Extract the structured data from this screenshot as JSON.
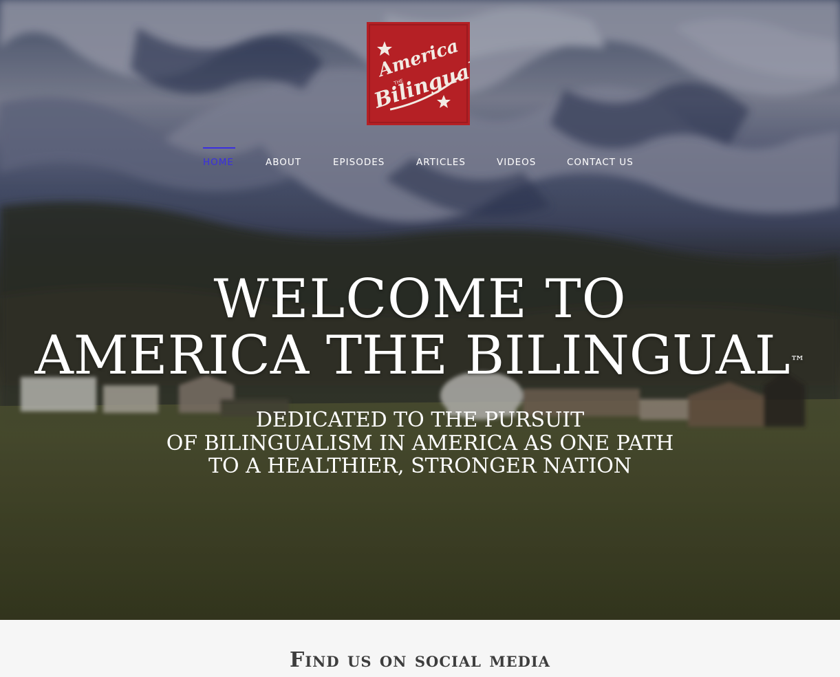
{
  "logo": {
    "line1": "America",
    "line_small": "THE",
    "line2": "Bilingual",
    "background": "#b52025"
  },
  "nav": {
    "items": [
      {
        "label": "HOME",
        "active": true
      },
      {
        "label": "ABOUT"
      },
      {
        "label": "EPISODES"
      },
      {
        "label": "ARTICLES"
      },
      {
        "label": "VIDEOS"
      },
      {
        "label": "CONTACT US"
      }
    ],
    "active_color": "#3a2fe0"
  },
  "hero": {
    "title_line1": "WELCOME TO",
    "title_line2": "AMERICA THE BILINGUAL",
    "trademark": "™",
    "subtitle_line1": "DEDICATED TO THE PURSUIT",
    "subtitle_line2": "OF BILINGUALISM IN AMERICA AS ONE PATH",
    "subtitle_line3": "TO A HEALTHIER, STRONGER NATION"
  },
  "social": {
    "title": "Find us on social media"
  }
}
